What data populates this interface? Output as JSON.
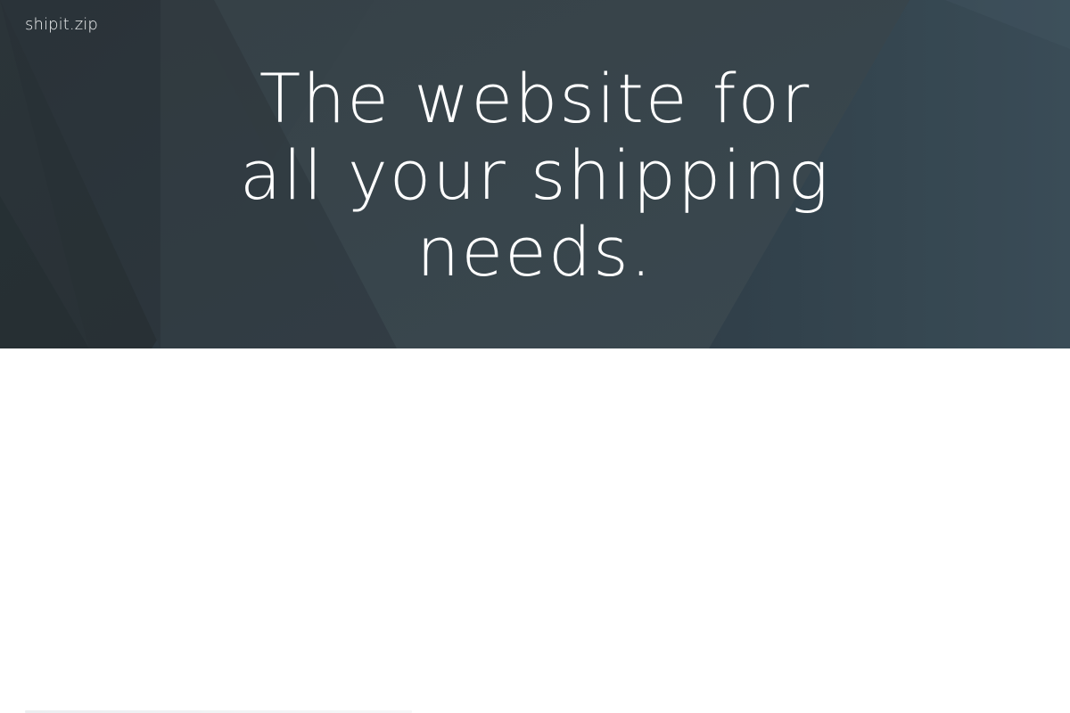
{
  "header": {
    "logo_text": "shipit.zip"
  },
  "hero": {
    "headline_lines": [
      "The website for",
      "all your shipping",
      "needs."
    ]
  },
  "colors": {
    "hero_base": "#34414a",
    "text": "#ffffff"
  }
}
